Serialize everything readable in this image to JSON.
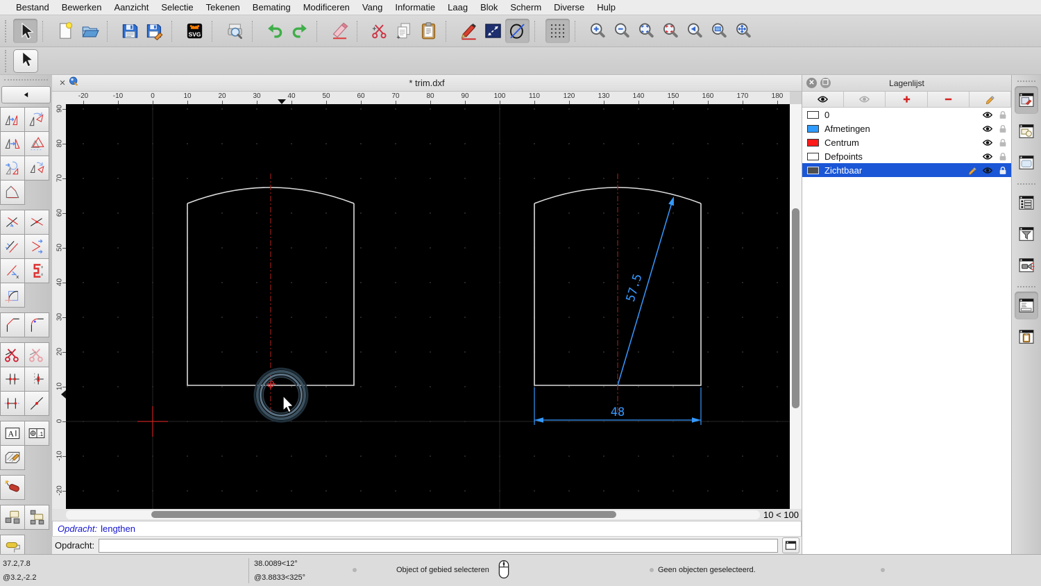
{
  "menu": {
    "items": [
      "Bestand",
      "Bewerken",
      "Aanzicht",
      "Selectie",
      "Tekenen",
      "Bemating",
      "Modificeren",
      "Vang",
      "Informatie",
      "Laag",
      "Blok",
      "Scherm",
      "Diverse",
      "Hulp"
    ]
  },
  "toolbar": {
    "svg_badge": "SVG",
    "groups": [
      [
        {
          "name": "selection-arrow",
          "active": true
        }
      ],
      [
        {
          "name": "new-file"
        },
        {
          "name": "open-file"
        }
      ],
      [
        {
          "name": "save"
        },
        {
          "name": "save-as"
        }
      ],
      [
        {
          "name": "svg-export"
        }
      ],
      [
        {
          "name": "print-preview"
        }
      ],
      [
        {
          "name": "undo"
        },
        {
          "name": "redo"
        }
      ],
      [
        {
          "name": "delete-eraser"
        }
      ],
      [
        {
          "name": "cut"
        },
        {
          "name": "copy"
        },
        {
          "name": "paste"
        }
      ],
      [
        {
          "name": "pen-attributes"
        },
        {
          "name": "dimension-style"
        },
        {
          "name": "isometric-circle",
          "active": true
        }
      ],
      [
        {
          "name": "grid-toggle",
          "active": true
        }
      ],
      [
        {
          "name": "zoom-in"
        },
        {
          "name": "zoom-out"
        },
        {
          "name": "zoom-auto"
        },
        {
          "name": "zoom-previous"
        },
        {
          "name": "zoom-back"
        },
        {
          "name": "zoom-window"
        },
        {
          "name": "zoom-pan"
        }
      ]
    ]
  },
  "tools": {
    "glyphs": {
      "divide_x": "x",
      "text_tool": "A",
      "dim_text": ".1"
    },
    "rows": [
      [
        "move-copy",
        "rotate"
      ],
      [
        "mirror",
        "scale"
      ],
      [
        "move-rotate",
        "rotate-two"
      ],
      [
        "edit-polyline"
      ],
      [],
      [
        "trim",
        "trim-two"
      ],
      [
        "offset",
        "stretch-move"
      ],
      [
        "lengthen",
        "clamp"
      ],
      [
        "arc-tool"
      ],
      [],
      [
        "bevel",
        "round-corner"
      ],
      [],
      [
        "divide",
        "divide-two"
      ],
      [
        "break-out",
        "break-out-manual"
      ],
      [
        "stretch",
        "move-point"
      ],
      [],
      [
        "edit-text",
        "edit-dimension"
      ],
      [
        "edit-hatch"
      ],
      [],
      [
        "explode"
      ],
      [],
      [
        "block-edit",
        "block-edit-copy"
      ],
      [],
      [
        "paint-order"
      ]
    ]
  },
  "tab": {
    "title": "* trim.dxf"
  },
  "ruler": {
    "h_ticks": [
      "-20",
      "-10",
      "0",
      "10",
      "20",
      "30",
      "40",
      "50",
      "60",
      "70",
      "80",
      "90",
      "100",
      "110",
      "120",
      "130",
      "140",
      "150",
      "160",
      "170",
      "180"
    ],
    "v_ticks": [
      "90",
      "80",
      "70",
      "60",
      "50",
      "40",
      "30",
      "20",
      "10",
      "0",
      "-10",
      "-20"
    ]
  },
  "drawing": {
    "dim_diagonal": "57.5",
    "dim_width": "48",
    "colors": {
      "outline": "#dcdcdc",
      "centerline": "#8b1d15",
      "dimension": "#3598ff",
      "origin": "#c42222",
      "grid_dot": "#303030",
      "meta_line": "#262626"
    }
  },
  "canvas": {
    "grid_status": "10 < 100"
  },
  "command": {
    "history_label": "Opdracht:",
    "history_value": "lengthen",
    "prompt_label": "Opdracht:",
    "input_value": ""
  },
  "layers": {
    "title": "Lagenlijst",
    "items": [
      {
        "name": "0",
        "color": "#ffffff",
        "selected": false
      },
      {
        "name": "Afmetingen",
        "color": "#2f9bff",
        "selected": false
      },
      {
        "name": "Centrum",
        "color": "#ff1a1a",
        "selected": false
      },
      {
        "name": "Defpoints",
        "color": "#ffffff",
        "selected": false
      },
      {
        "name": "Zichtbaar",
        "color": "#4f4f4f",
        "selected": true
      }
    ]
  },
  "dock": {
    "groups": [
      [
        {
          "name": "property-editor",
          "active": true
        },
        {
          "name": "block-list"
        },
        {
          "name": "library-browser"
        }
      ],
      [
        {
          "name": "list-view"
        },
        {
          "name": "selection-filter"
        },
        {
          "name": "command-trigger"
        }
      ],
      [
        {
          "name": "command-line",
          "active": true
        },
        {
          "name": "clipboard-panel"
        }
      ]
    ]
  },
  "status": {
    "abs_coord": "37.2,7.8",
    "rel_coord": "@3.2,-2.2",
    "abs_polar": "38.0089<12°",
    "rel_polar": "@3.8833<325°",
    "hint": "Object of gebied selecteren",
    "selection": "Geen objecten geselecteerd."
  }
}
